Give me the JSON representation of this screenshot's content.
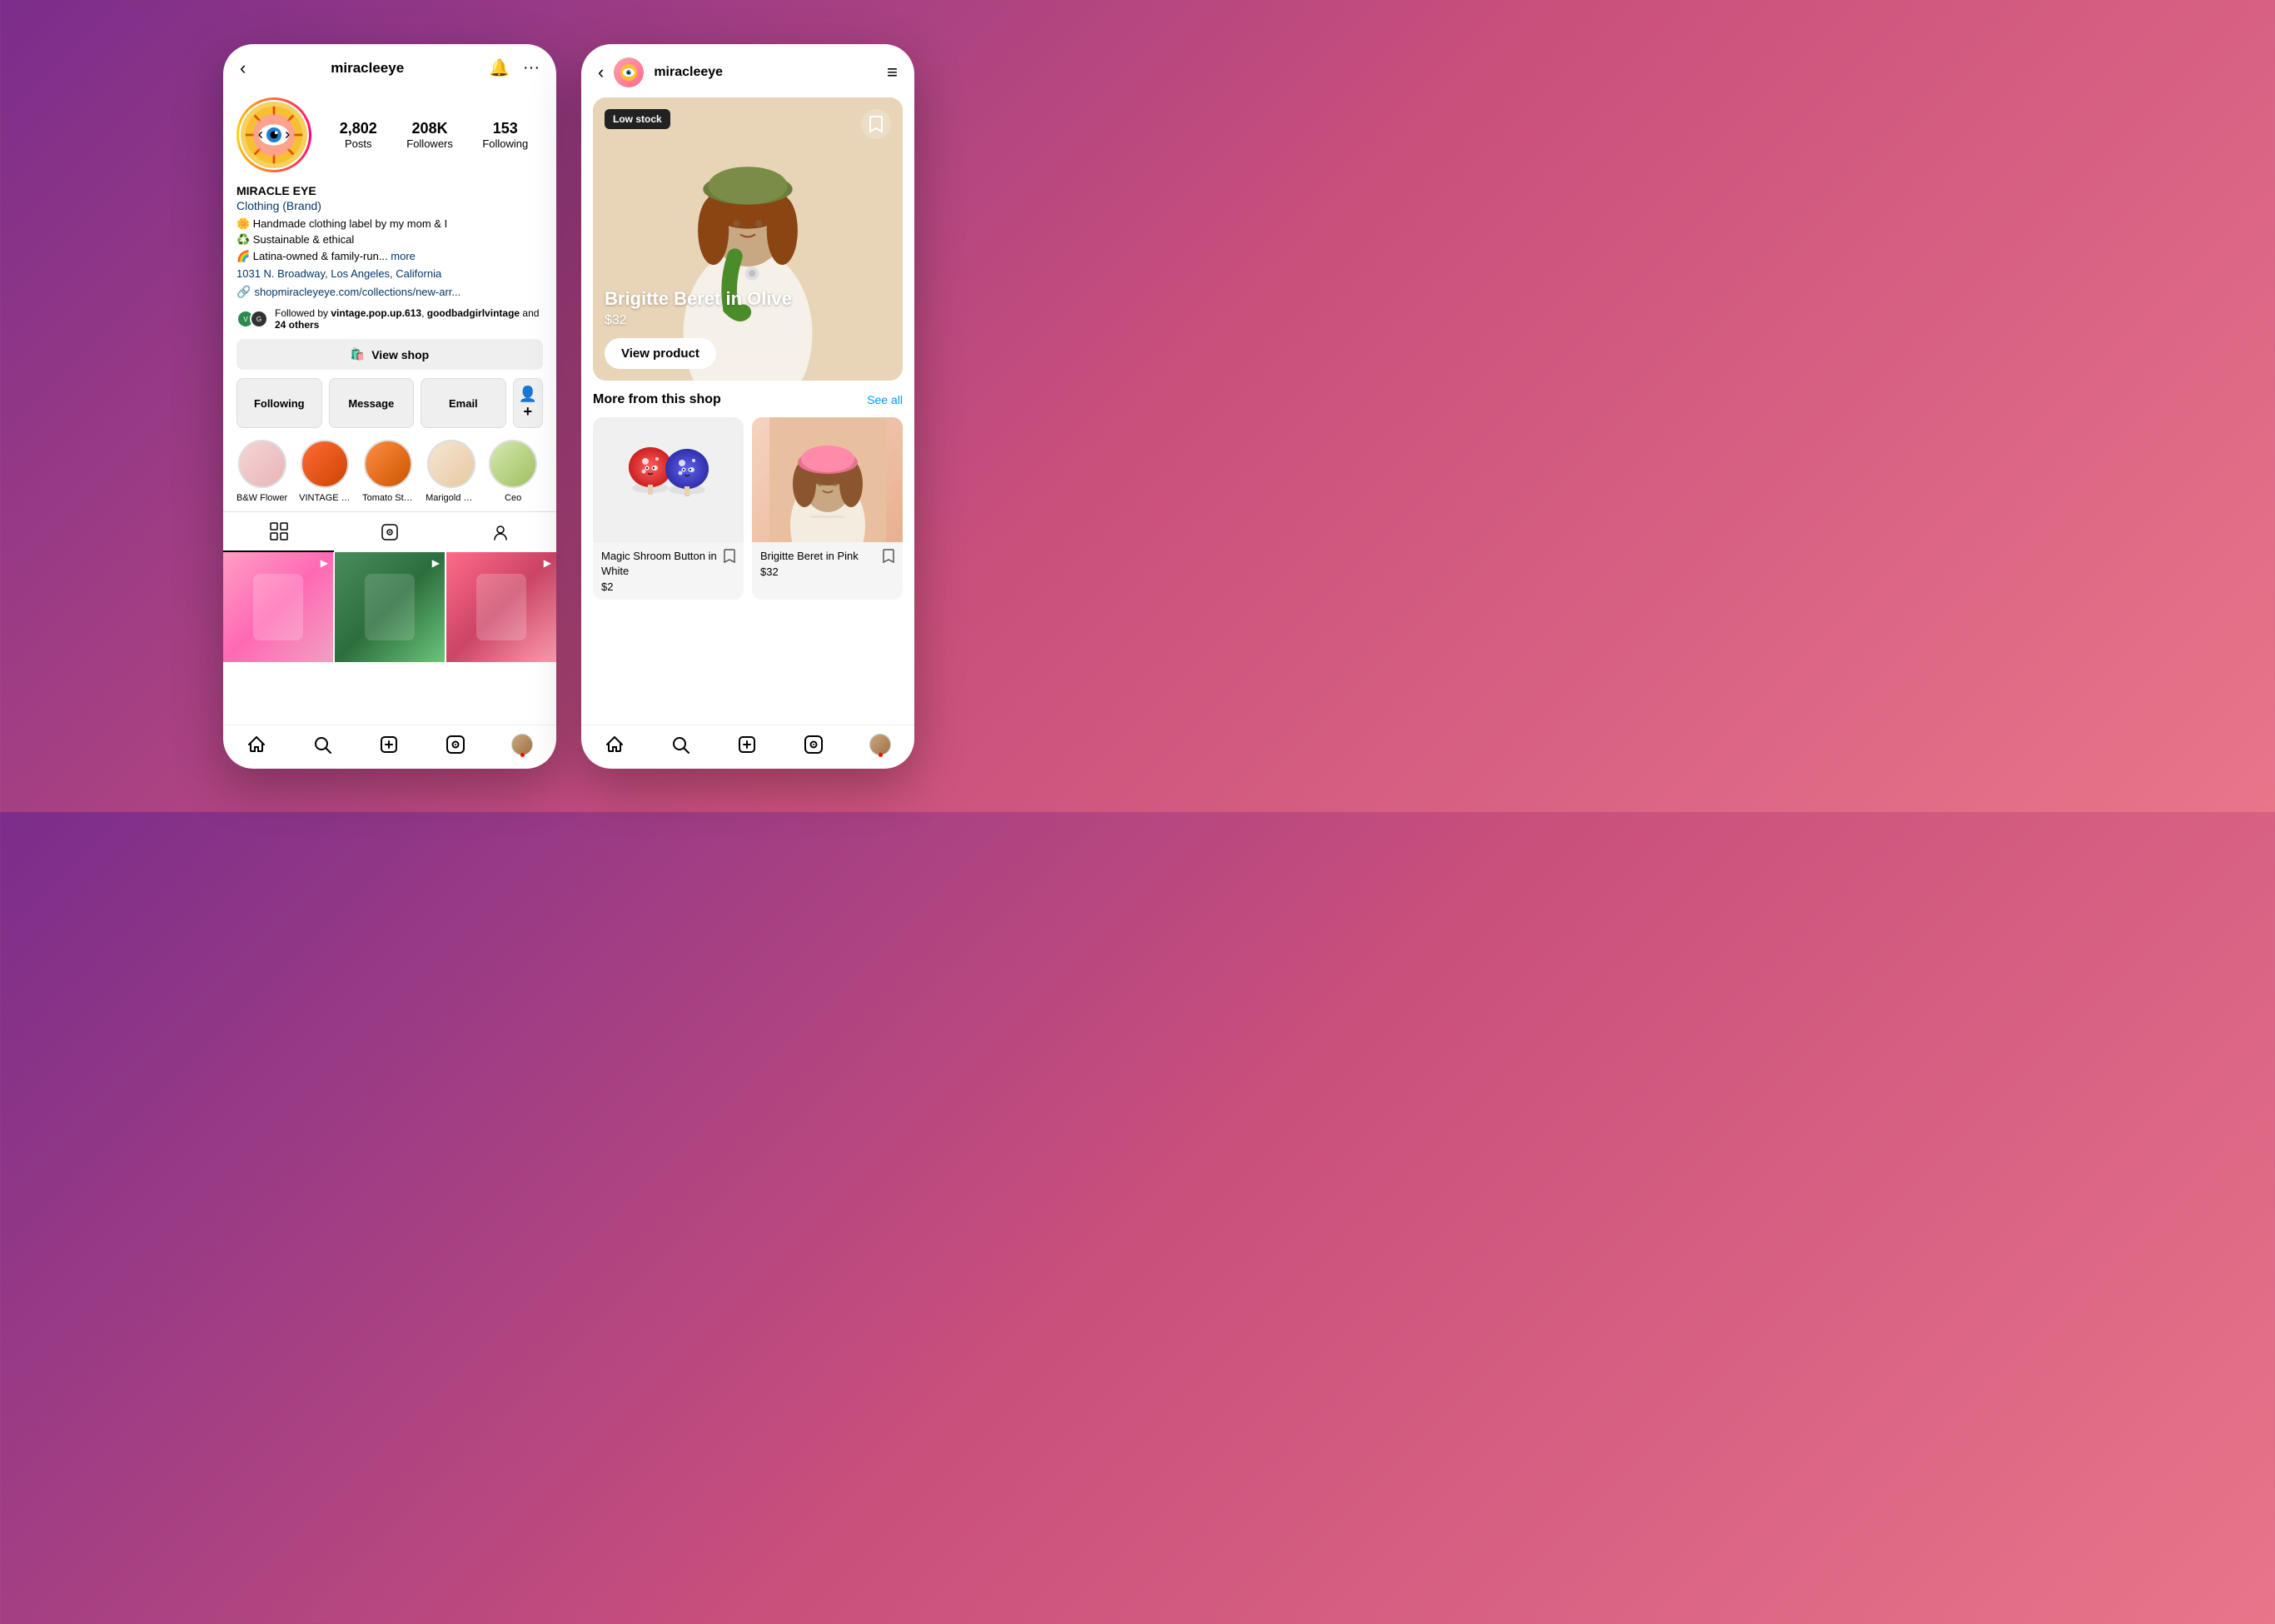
{
  "background": {
    "gradient_start": "#7b2d8b",
    "gradient_end": "#e8758a"
  },
  "left_phone": {
    "header": {
      "back_label": "‹",
      "username": "miracleeye",
      "bell_icon": "🔔",
      "more_icon": "···"
    },
    "profile": {
      "name": "MIRACLE EYE",
      "category": "Clothing (Brand)",
      "bio_lines": [
        "🌼 Handmade clothing label by my mom & I",
        "♻️ Sustainable & ethical",
        "🌈 Latina-owned & family-run... more"
      ],
      "location": "1031 N. Broadway, Los Angeles, California",
      "link": "shopmiracleyeye.com/collections/new-arr...",
      "followed_by_text": "Followed by vintage.pop.up.613, goodbadgirlvintage and 24 others",
      "stats": {
        "posts_count": "2,802",
        "posts_label": "Posts",
        "followers_count": "208K",
        "followers_label": "Followers",
        "following_count": "153",
        "following_label": "Following"
      }
    },
    "buttons": {
      "view_shop": "View shop",
      "following": "Following",
      "message": "Message",
      "email": "Email"
    },
    "highlights": [
      {
        "label": "B&W Flower"
      },
      {
        "label": "VINTAGE S..."
      },
      {
        "label": "Tomato Stri..."
      },
      {
        "label": "Marigold BTS"
      },
      {
        "label": "Ceo"
      }
    ],
    "tabs": {
      "grid": "⊞",
      "reels": "▷",
      "tagged": "👤"
    },
    "grid_posts": [
      {
        "type": "video",
        "color_class": "post-1"
      },
      {
        "type": "video",
        "color_class": "post-2"
      },
      {
        "type": "video",
        "color_class": "post-3"
      }
    ],
    "bottom_nav": {
      "items": [
        {
          "icon": "⌂",
          "label": "home"
        },
        {
          "icon": "🔍",
          "label": "search"
        },
        {
          "icon": "⊕",
          "label": "create"
        },
        {
          "icon": "▶",
          "label": "reels"
        },
        {
          "icon": "",
          "label": "profile"
        }
      ]
    }
  },
  "right_phone": {
    "header": {
      "back_label": "‹",
      "username": "miracleeye",
      "hamburger": "≡"
    },
    "featured_product": {
      "badge": "Low stock",
      "title": "Brigitte Beret in Olive",
      "price": "$32",
      "cta": "View product"
    },
    "more_section": {
      "title": "More from this shop",
      "see_all": "See all"
    },
    "products": [
      {
        "name": "Magic Shroom Button in White",
        "price": "$2",
        "image_type": "mushroom"
      },
      {
        "name": "Brigitte Beret in Pink",
        "price": "$32",
        "image_type": "person"
      }
    ],
    "bottom_nav": {
      "items": [
        {
          "icon": "⌂",
          "label": "home"
        },
        {
          "icon": "🔍",
          "label": "search"
        },
        {
          "icon": "⊕",
          "label": "create"
        },
        {
          "icon": "▶",
          "label": "reels"
        },
        {
          "icon": "",
          "label": "profile"
        }
      ]
    }
  }
}
